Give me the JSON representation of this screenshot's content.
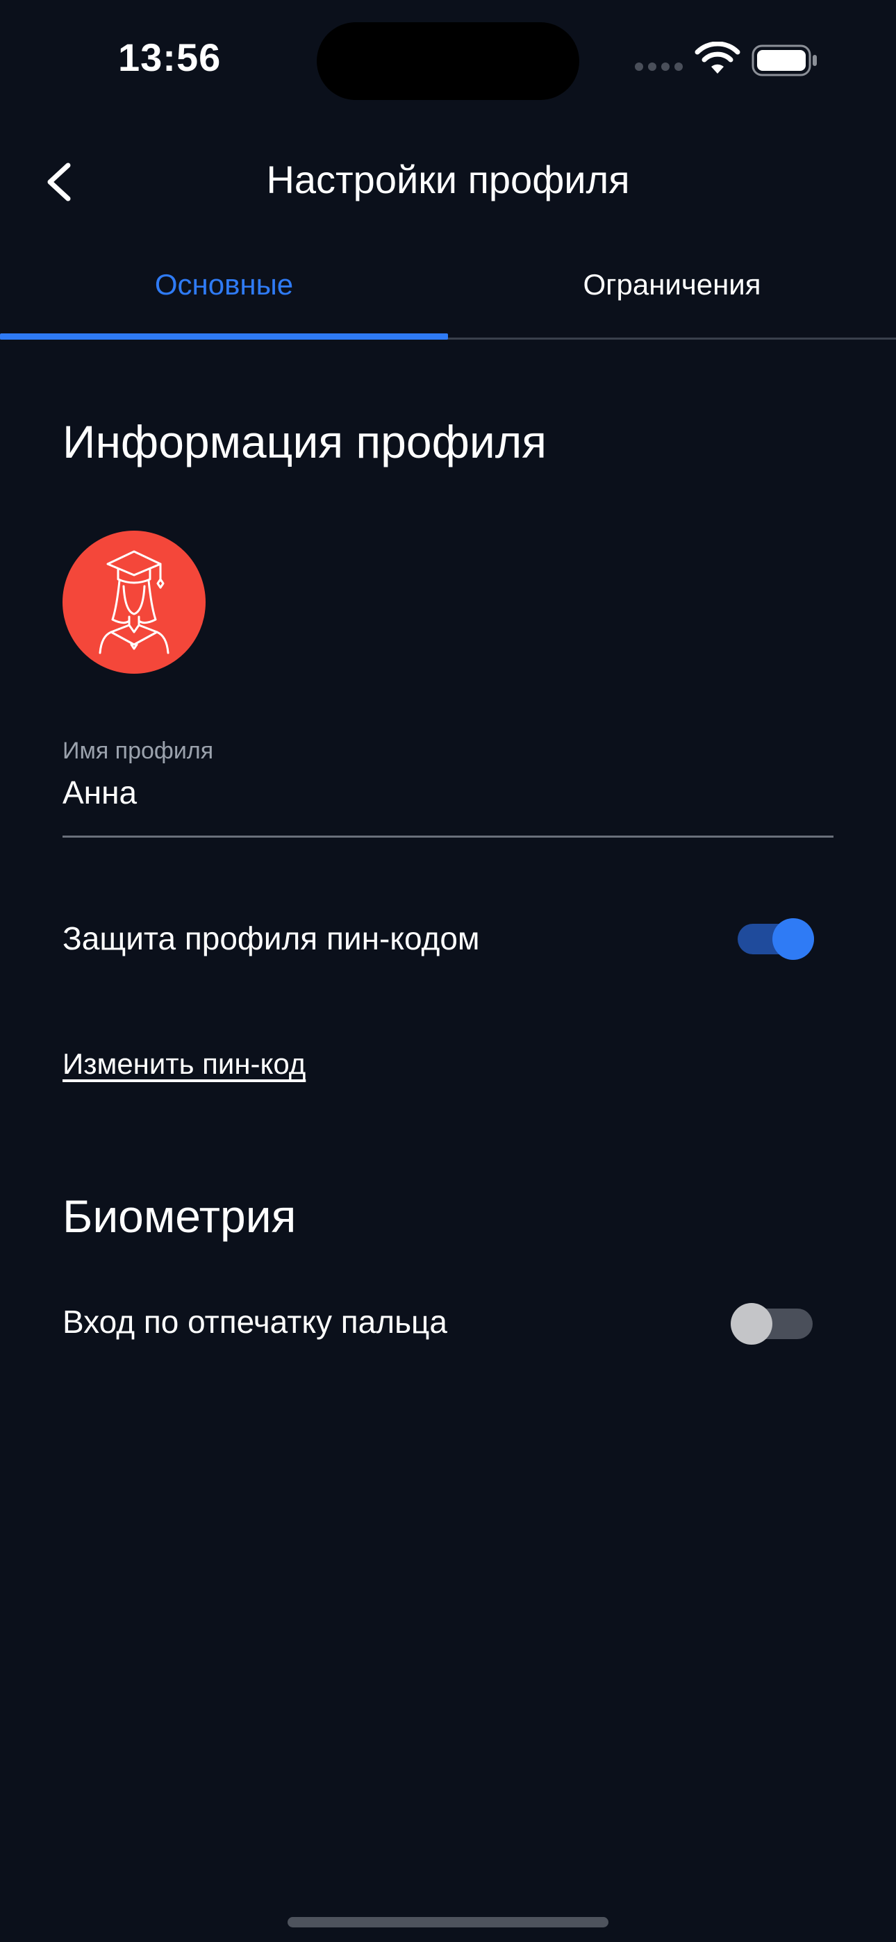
{
  "status_bar": {
    "time": "13:56",
    "icons": [
      "signal-icon",
      "wifi-icon",
      "battery-icon"
    ]
  },
  "nav": {
    "title": "Настройки профиля",
    "back_icon": "chevron-left-icon"
  },
  "tabs": [
    {
      "label": "Основные",
      "active": true
    },
    {
      "label": "Ограничения",
      "active": false
    }
  ],
  "profile_info": {
    "section_title": "Информация профиля",
    "avatar_icon": "graduate-avatar-icon",
    "name_field": {
      "label": "Имя профиля",
      "value": "Анна"
    },
    "pin_protection": {
      "label": "Защита профиля пин-кодом",
      "enabled": true
    },
    "change_pin_link": "Изменить пин-код"
  },
  "biometrics": {
    "section_title": "Биометрия",
    "fingerprint_login": {
      "label": "Вход по отпечатку пальца",
      "enabled": false
    }
  },
  "colors": {
    "background": "#0b101b",
    "accent": "#2f7bf5",
    "avatar": "#f4473a"
  }
}
